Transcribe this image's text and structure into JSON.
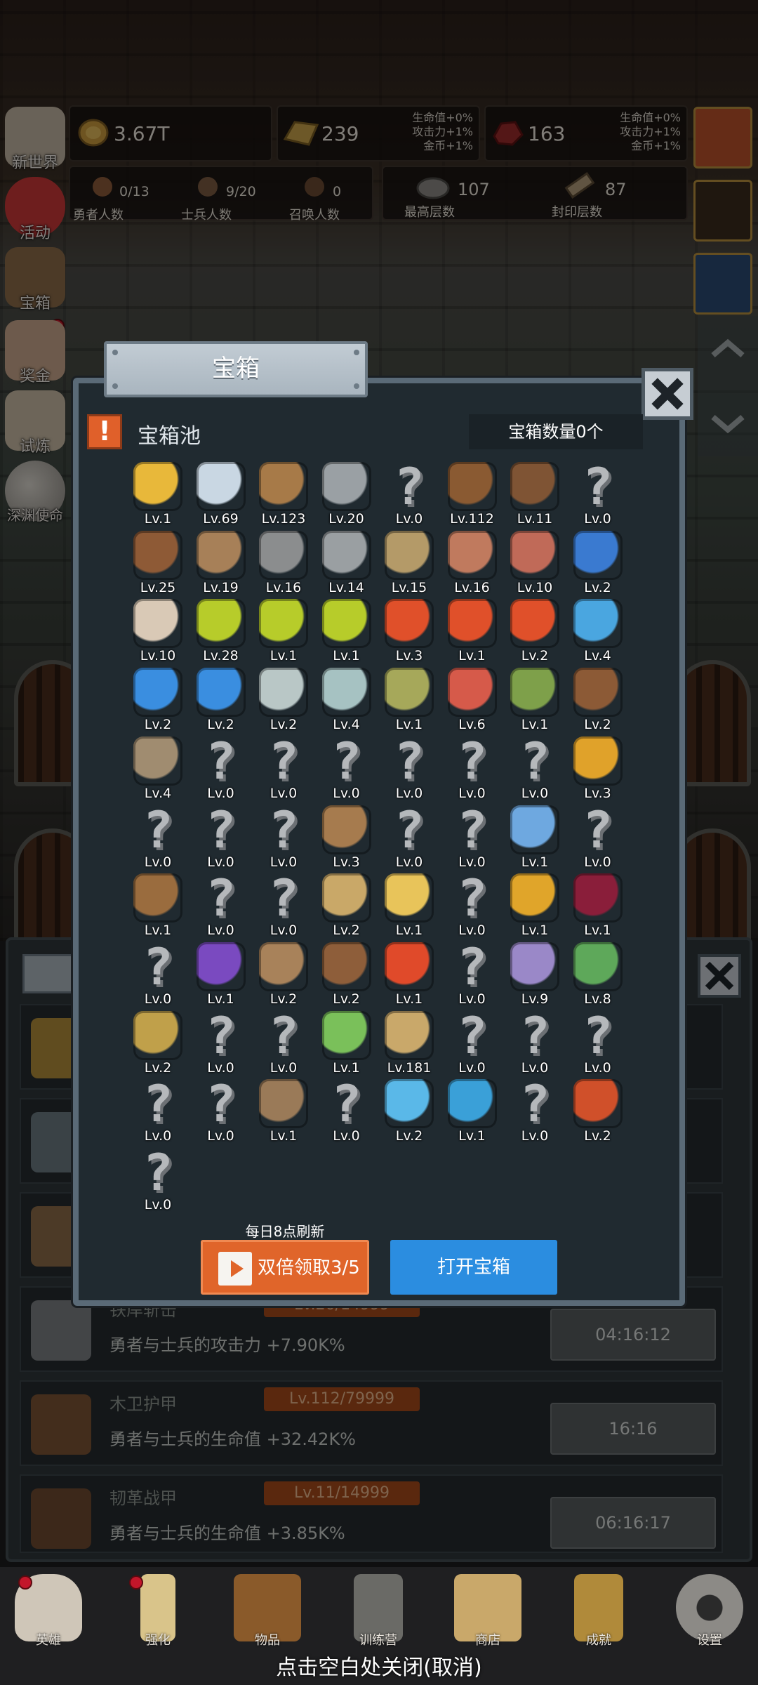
{
  "resources": {
    "gold": {
      "value": "3.67T",
      "icon": "gold-coin-icon"
    },
    "bars": {
      "value": "239",
      "icon": "gold-bar-icon",
      "bonus": [
        "生命值+0%",
        "攻击力+1%",
        "金币+1%"
      ]
    },
    "ore": {
      "value": "163",
      "icon": "red-ore-icon",
      "bonus": [
        "生命值+0%",
        "攻击力+1%",
        "金币+1%"
      ]
    }
  },
  "counts": {
    "heroes": {
      "value": "0/13",
      "label": "勇者人数"
    },
    "soldiers": {
      "value": "9/20",
      "label": "士兵人数"
    },
    "summons": {
      "value": "0",
      "label": "召唤人数"
    },
    "highest_floor": {
      "value": "107",
      "label": "最高层数"
    },
    "sealed_floor": {
      "value": "87",
      "label": "封印层数"
    }
  },
  "side_menu": [
    {
      "label": "新世界",
      "icon": "scroll-map-icon"
    },
    {
      "label": "活动",
      "icon": "heart-icon"
    },
    {
      "label": "宝箱",
      "icon": "chest-icon"
    },
    {
      "label": "奖金",
      "icon": "envelope-icon"
    },
    {
      "label": "试炼",
      "icon": "feather-icon"
    },
    {
      "label": "深渊使命",
      "icon": "orb-icon"
    }
  ],
  "modal": {
    "title": "宝箱",
    "pool_title": "宝箱池",
    "chest_count": "宝箱数量0个",
    "refresh_note": "每日8点刷新",
    "double_button": "双倍领取3/5",
    "open_button": "打开宝箱"
  },
  "grid_items": [
    {
      "lv": "Lv.1",
      "icon": "crown-icon",
      "color": "#e8b83a"
    },
    {
      "lv": "Lv.69",
      "icon": "diamond-icon",
      "color": "#c9d7e3"
    },
    {
      "lv": "Lv.123",
      "icon": "wooden-sword-icon",
      "color": "#a77a48"
    },
    {
      "lv": "Lv.20",
      "icon": "iron-sword-icon",
      "color": "#9aa0a4"
    },
    {
      "lv": "Lv.0",
      "icon": "unknown-icon"
    },
    {
      "lv": "Lv.112",
      "icon": "wooden-armor-icon",
      "color": "#8a5a32"
    },
    {
      "lv": "Lv.11",
      "icon": "leather-armor-icon",
      "color": "#7f5434"
    },
    {
      "lv": "Lv.0",
      "icon": "unknown-icon"
    },
    {
      "lv": "Lv.25",
      "icon": "leather-hood-icon",
      "color": "#8e5a36"
    },
    {
      "lv": "Lv.19",
      "icon": "dagger-icon",
      "color": "#a78058"
    },
    {
      "lv": "Lv.16",
      "icon": "knight-helmet-icon",
      "color": "#8b8d8e"
    },
    {
      "lv": "Lv.14",
      "icon": "hammer-icon",
      "color": "#9a9fa2"
    },
    {
      "lv": "Lv.15",
      "icon": "great-helm-icon",
      "color": "#b49a68"
    },
    {
      "lv": "Lv.16",
      "icon": "ham-icon",
      "color": "#c07a5e"
    },
    {
      "lv": "Lv.10",
      "icon": "steak-icon",
      "color": "#c06a58"
    },
    {
      "lv": "Lv.2",
      "icon": "loot-bag-icon",
      "color": "#3a7ad0"
    },
    {
      "lv": "Lv.10",
      "icon": "bread-icon",
      "color": "#d9c9b6"
    },
    {
      "lv": "Lv.28",
      "icon": "green-potion-icon",
      "color": "#b7cc2a"
    },
    {
      "lv": "Lv.1",
      "icon": "green-potion-icon",
      "color": "#b7cc2a"
    },
    {
      "lv": "Lv.1",
      "icon": "green-potion-icon",
      "color": "#b7cc2a"
    },
    {
      "lv": "Lv.3",
      "icon": "red-potion-icon",
      "color": "#e0502a"
    },
    {
      "lv": "Lv.1",
      "icon": "red-potion-icon",
      "color": "#e0502a"
    },
    {
      "lv": "Lv.2",
      "icon": "red-potion-icon",
      "color": "#e0502a"
    },
    {
      "lv": "Lv.4",
      "icon": "blue-potion-icon",
      "color": "#4aa6e0"
    },
    {
      "lv": "Lv.2",
      "icon": "blue-potion-icon",
      "color": "#3a8ee0"
    },
    {
      "lv": "Lv.2",
      "icon": "blue-potion-icon",
      "color": "#3a8ee0"
    },
    {
      "lv": "Lv.2",
      "icon": "vial-icon",
      "color": "#b9c7c6"
    },
    {
      "lv": "Lv.4",
      "icon": "vial-icon",
      "color": "#a6c2c2"
    },
    {
      "lv": "Lv.1",
      "icon": "bottle-icon",
      "color": "#a6a85a"
    },
    {
      "lv": "Lv.6",
      "icon": "red-bottle-icon",
      "color": "#d65a4a"
    },
    {
      "lv": "Lv.1",
      "icon": "winged-boot-icon",
      "color": "#7ea04a"
    },
    {
      "lv": "Lv.2",
      "icon": "boot-icon",
      "color": "#8c5a36"
    },
    {
      "lv": "Lv.4",
      "icon": "cloth-shoe-icon",
      "color": "#a08c70"
    },
    {
      "lv": "Lv.0",
      "icon": "unknown-icon"
    },
    {
      "lv": "Lv.0",
      "icon": "unknown-icon"
    },
    {
      "lv": "Lv.0",
      "icon": "unknown-icon"
    },
    {
      "lv": "Lv.0",
      "icon": "unknown-icon"
    },
    {
      "lv": "Lv.0",
      "icon": "unknown-icon"
    },
    {
      "lv": "Lv.0",
      "icon": "unknown-icon"
    },
    {
      "lv": "Lv.3",
      "icon": "torch-icon",
      "color": "#e0a22a"
    },
    {
      "lv": "Lv.0",
      "icon": "unknown-icon"
    },
    {
      "lv": "Lv.0",
      "icon": "unknown-icon"
    },
    {
      "lv": "Lv.0",
      "icon": "unknown-icon"
    },
    {
      "lv": "Lv.3",
      "icon": "wooden-staff-icon",
      "color": "#a67b4e"
    },
    {
      "lv": "Lv.0",
      "icon": "unknown-icon"
    },
    {
      "lv": "Lv.0",
      "icon": "unknown-icon"
    },
    {
      "lv": "Lv.1",
      "icon": "blue-wand-icon",
      "color": "#6ea8e0"
    },
    {
      "lv": "Lv.0",
      "icon": "unknown-icon"
    },
    {
      "lv": "Lv.1",
      "icon": "backpack-icon",
      "color": "#9a6c3e"
    },
    {
      "lv": "Lv.0",
      "icon": "unknown-icon"
    },
    {
      "lv": "Lv.0",
      "icon": "unknown-icon"
    },
    {
      "lv": "Lv.2",
      "icon": "broom-icon",
      "color": "#c9a868"
    },
    {
      "lv": "Lv.1",
      "icon": "cheese-icon",
      "color": "#e8c45a"
    },
    {
      "lv": "Lv.0",
      "icon": "unknown-icon"
    },
    {
      "lv": "Lv.1",
      "icon": "honey-jar-icon",
      "color": "#e0a52a"
    },
    {
      "lv": "Lv.1",
      "icon": "dark-crystal-icon",
      "color": "#8a1e3a"
    },
    {
      "lv": "Lv.0",
      "icon": "unknown-icon"
    },
    {
      "lv": "Lv.1",
      "icon": "magic-cube-icon",
      "color": "#7a4ac0"
    },
    {
      "lv": "Lv.2",
      "icon": "bow-icon",
      "color": "#a8825a"
    },
    {
      "lv": "Lv.2",
      "icon": "quiver-icon",
      "color": "#8e5e3a"
    },
    {
      "lv": "Lv.1",
      "icon": "fire-gauntlet-icon",
      "color": "#e04a2a"
    },
    {
      "lv": "Lv.0",
      "icon": "unknown-icon"
    },
    {
      "lv": "Lv.9",
      "icon": "octopus-icon",
      "color": "#9a88c8"
    },
    {
      "lv": "Lv.8",
      "icon": "rune-amulet-icon",
      "color": "#5ea85a"
    },
    {
      "lv": "Lv.2",
      "icon": "scroll-vial-icon",
      "color": "#c0a04a"
    },
    {
      "lv": "Lv.0",
      "icon": "unknown-icon"
    },
    {
      "lv": "Lv.0",
      "icon": "unknown-icon"
    },
    {
      "lv": "Lv.1",
      "icon": "green-wand-icon",
      "color": "#7ac05a"
    },
    {
      "lv": "Lv.181",
      "icon": "beer-mug-icon",
      "color": "#c9a86a"
    },
    {
      "lv": "Lv.0",
      "icon": "unknown-icon"
    },
    {
      "lv": "Lv.0",
      "icon": "unknown-icon"
    },
    {
      "lv": "Lv.0",
      "icon": "unknown-icon"
    },
    {
      "lv": "Lv.0",
      "icon": "unknown-icon"
    },
    {
      "lv": "Lv.0",
      "icon": "unknown-icon"
    },
    {
      "lv": "Lv.1",
      "icon": "harp-bow-icon",
      "color": "#9a7a58"
    },
    {
      "lv": "Lv.0",
      "icon": "unknown-icon"
    },
    {
      "lv": "Lv.2",
      "icon": "crystal-ball-icon",
      "color": "#5ab8e8"
    },
    {
      "lv": "Lv.1",
      "icon": "rune-shield-icon",
      "color": "#3aa0d8"
    },
    {
      "lv": "Lv.0",
      "icon": "unknown-icon"
    },
    {
      "lv": "Lv.2",
      "icon": "fire-staff-icon",
      "color": "#d0502a"
    },
    {
      "lv": "Lv.0",
      "icon": "unknown-icon"
    }
  ],
  "lower_list": [
    {
      "name": "铁岸斩击",
      "level": "Lv.20/14999",
      "desc": "勇者与士兵的攻击力 +7.90K%",
      "timer": "04:16:12",
      "icon": "iron-sword-icon"
    },
    {
      "name": "木卫护甲",
      "level": "Lv.112/79999",
      "desc": "勇者与士兵的生命值 +32.42K%",
      "timer": "16:16",
      "icon": "wooden-armor-icon"
    },
    {
      "name": "韧革战甲",
      "level": "Lv.11/14999",
      "desc": "勇者与士兵的生命值 +3.85K%",
      "timer": "06:16:17",
      "icon": "leather-armor-icon"
    }
  ],
  "bottom_nav": [
    {
      "label": "英雄",
      "icon": "skull-icon",
      "dot": true
    },
    {
      "label": "强化",
      "icon": "candle-icon",
      "dot": true
    },
    {
      "label": "物品",
      "icon": "book-icon",
      "dot": false
    },
    {
      "label": "训练营",
      "icon": "lantern-icon",
      "dot": false
    },
    {
      "label": "商店",
      "icon": "mug-icon",
      "dot": false
    },
    {
      "label": "成就",
      "icon": "key-icon",
      "dot": false
    },
    {
      "label": "设置",
      "icon": "gear-icon",
      "dot": false
    }
  ],
  "close_hint": "点击空白处关闭(取消)"
}
